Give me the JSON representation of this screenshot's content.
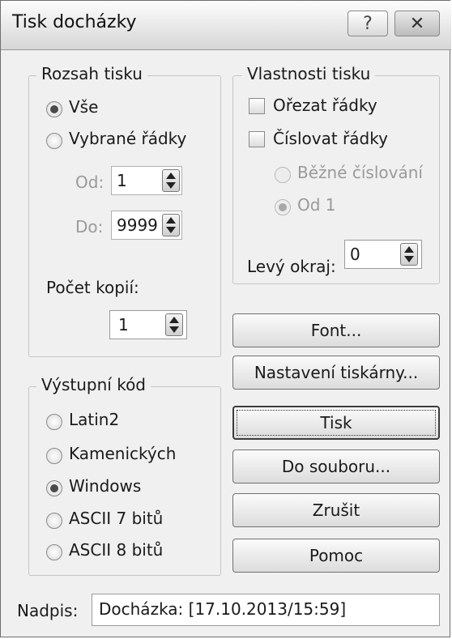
{
  "window": {
    "title": "Tisk docházky",
    "help_label": "?",
    "close_label": "✕"
  },
  "range_group": {
    "label": "Rozsah tisku",
    "options": [
      {
        "label": "Vše",
        "selected": true
      },
      {
        "label": "Vybrané řádky",
        "selected": false
      }
    ],
    "from_label": "Od:",
    "from_value": "1",
    "to_label": "Do:",
    "to_value": "9999",
    "copies_label": "Počet kopií:",
    "copies_value": "1"
  },
  "properties_group": {
    "label": "Vlastnosti tisku",
    "trim_rows_label": "Ořezat řádky",
    "trim_rows_checked": false,
    "number_rows_label": "Číslovat řádky",
    "number_rows_checked": false,
    "numbering_options": [
      {
        "label": "Běžné číslování",
        "selected": false
      },
      {
        "label": "Od 1",
        "selected": true
      }
    ],
    "left_margin_label": "Levý okraj:",
    "left_margin_value": "0"
  },
  "output_group": {
    "label": "Výstupní kód",
    "options": [
      {
        "label": "Latin2",
        "selected": false
      },
      {
        "label": "Kamenických",
        "selected": false
      },
      {
        "label": "Windows",
        "selected": true
      },
      {
        "label": "ASCII 7 bitů",
        "selected": false
      },
      {
        "label": "ASCII 8 bitů",
        "selected": false
      }
    ]
  },
  "buttons": {
    "font": "Font...",
    "printer_setup": "Nastavení tiskárny...",
    "print": "Tisk",
    "to_file": "Do souboru...",
    "cancel": "Zrušit",
    "help": "Pomoc"
  },
  "heading": {
    "label": "Nadpis:",
    "value": "Docházka: [17.10.2013/15:59]"
  }
}
